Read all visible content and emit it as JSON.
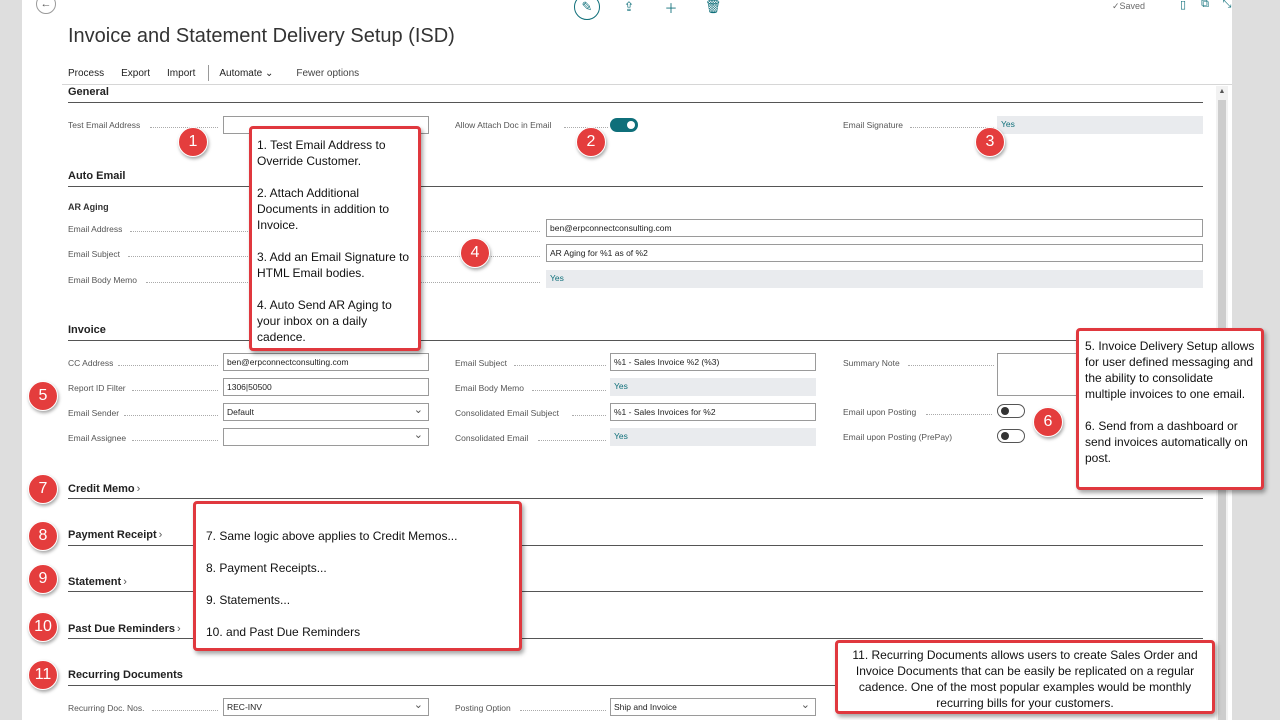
{
  "app": {
    "title": "Invoice and Statement Delivery Setup (ISD)",
    "saved": "Saved",
    "back_icon": "arrow-left-icon",
    "top_icons": [
      "edit-icon",
      "share-icon",
      "plus-icon",
      "delete-icon"
    ],
    "right_tools": [
      "bookmark-icon",
      "open-new-window-icon",
      "collapse-icon"
    ]
  },
  "actions": {
    "process": "Process",
    "export": "Export",
    "import": "Import",
    "automate": "Automate",
    "fewer": "Fewer options"
  },
  "general": {
    "title": "General",
    "test_email_label": "Test Email Address",
    "test_email_value": "",
    "allow_attach_label": "Allow Attach Doc in Email",
    "email_signature_label": "Email Signature",
    "email_signature_value": "Yes"
  },
  "auto_email": {
    "title": "Auto Email",
    "subtitle": "AR Aging",
    "email_address_label": "Email Address",
    "email_address_value": "ben@erpconnectconsulting.com",
    "email_subject_label": "Email Subject",
    "email_subject_value": "AR Aging for %1 as of %2",
    "body_memo_label": "Email Body Memo",
    "body_memo_value": "Yes"
  },
  "invoice": {
    "title": "Invoice",
    "cc_label": "CC Address",
    "cc_value": "ben@erpconnectconsulting.com",
    "report_label": "Report ID Filter",
    "report_value": "1306|50500",
    "sender_label": "Email Sender",
    "sender_value": "Default",
    "assignee_label": "Email Assignee",
    "assignee_value": "",
    "subject_label": "Email Subject",
    "subject_value": "%1 - Sales Invoice %2 (%3)",
    "body_memo_label": "Email Body Memo",
    "body_memo_value": "Yes",
    "cons_subject_label": "Consolidated Email Subject",
    "cons_subject_value": "%1 - Sales Invoices for %2",
    "cons_email_label": "Consolidated Email",
    "cons_email_value": "Yes",
    "summary_label": "Summary Note",
    "posting_label": "Email upon Posting",
    "posting_prepay_label": "Email upon Posting (PrePay)"
  },
  "sections": {
    "credit_memo": "Credit Memo",
    "payment_receipt": "Payment Receipt",
    "statement": "Statement",
    "past_due": "Past Due Reminders",
    "recurring": "Recurring Documents"
  },
  "recurring": {
    "doc_nos_label": "Recurring Doc. Nos.",
    "doc_nos_value": "REC-INV",
    "posting_option_label": "Posting Option",
    "posting_option_value": "Ship and Invoice"
  },
  "badges": [
    "1",
    "2",
    "3",
    "4",
    "5",
    "6",
    "7",
    "8",
    "9",
    "10",
    "11"
  ],
  "callouts": {
    "c1": {
      "l1": "1. Test Email Address to Override Customer.",
      "l2": "2. Attach Additional Documents in addition to Invoice.",
      "l3": "3. Add an Email Signature to HTML Email bodies.",
      "l4": "4. Auto Send AR Aging to your inbox on a daily cadence."
    },
    "c2": {
      "l1": "5. Invoice Delivery Setup allows for user defined messaging and the ability to consolidate multiple invoices to one email.",
      "l2": "6. Send from a dashboard or send invoices automatically on post."
    },
    "c3": {
      "l1": "7. Same logic above applies to Credit Memos...",
      "l2": "8. Payment Receipts...",
      "l3": "9. Statements...",
      "l4": "10. and Past Due Reminders"
    },
    "c4": {
      "l1": "11. Recurring Documents allows users to create Sales Order and Invoice Documents that can be easily be replicated on a regular cadence. One of the most popular examples would be monthly recurring bills for your customers."
    }
  },
  "colors": {
    "accent": "#0f6f7a",
    "callout_border": "#e0383e",
    "badge": "#e43d3d"
  }
}
